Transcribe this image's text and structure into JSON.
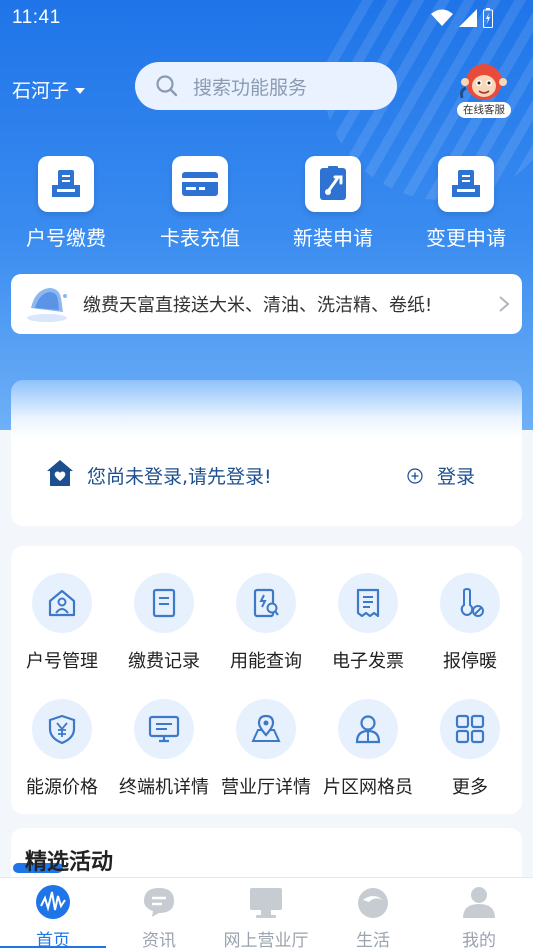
{
  "status_bar": {
    "time": "11:41"
  },
  "header": {
    "city": "石河子",
    "search_placeholder": "搜索功能服务",
    "customer_service_label": "在线客服"
  },
  "quick_actions": [
    {
      "label": "户号缴费",
      "icon": "ledger-icon"
    },
    {
      "label": "卡表充值",
      "icon": "card-icon"
    },
    {
      "label": "新装申请",
      "icon": "wrench-doc-icon"
    },
    {
      "label": "变更申请",
      "icon": "ledger-icon"
    }
  ],
  "notice": {
    "text": "缴费天富直接送大米、清油、洗洁精、卷纸!"
  },
  "login_card": {
    "message": "您尚未登录,请先登录!",
    "button": "登录"
  },
  "services": [
    {
      "label": "户号管理",
      "icon": "house-person-icon"
    },
    {
      "label": "缴费记录",
      "icon": "document-icon"
    },
    {
      "label": "用能查询",
      "icon": "search-doc-icon"
    },
    {
      "label": "电子发票",
      "icon": "receipt-icon"
    },
    {
      "label": "报停暖",
      "icon": "thermometer-icon"
    },
    {
      "label": "能源价格",
      "icon": "yuan-shield-icon"
    },
    {
      "label": "终端机详情",
      "icon": "monitor-icon"
    },
    {
      "label": "营业厅详情",
      "icon": "map-pin-icon"
    },
    {
      "label": "片区网格员",
      "icon": "person-icon"
    },
    {
      "label": "更多",
      "icon": "grid-icon"
    }
  ],
  "activities": {
    "title": "精选活动"
  },
  "tabbar": [
    {
      "label": "首页",
      "active": true
    },
    {
      "label": "资讯",
      "active": false
    },
    {
      "label": "网上营业厅",
      "active": false
    },
    {
      "label": "生活",
      "active": false
    },
    {
      "label": "我的",
      "active": false
    }
  ],
  "colors": {
    "primary": "#1f74e8",
    "icon_blue": "#3d79c8",
    "tab_inactive": "#9aa3ae"
  }
}
